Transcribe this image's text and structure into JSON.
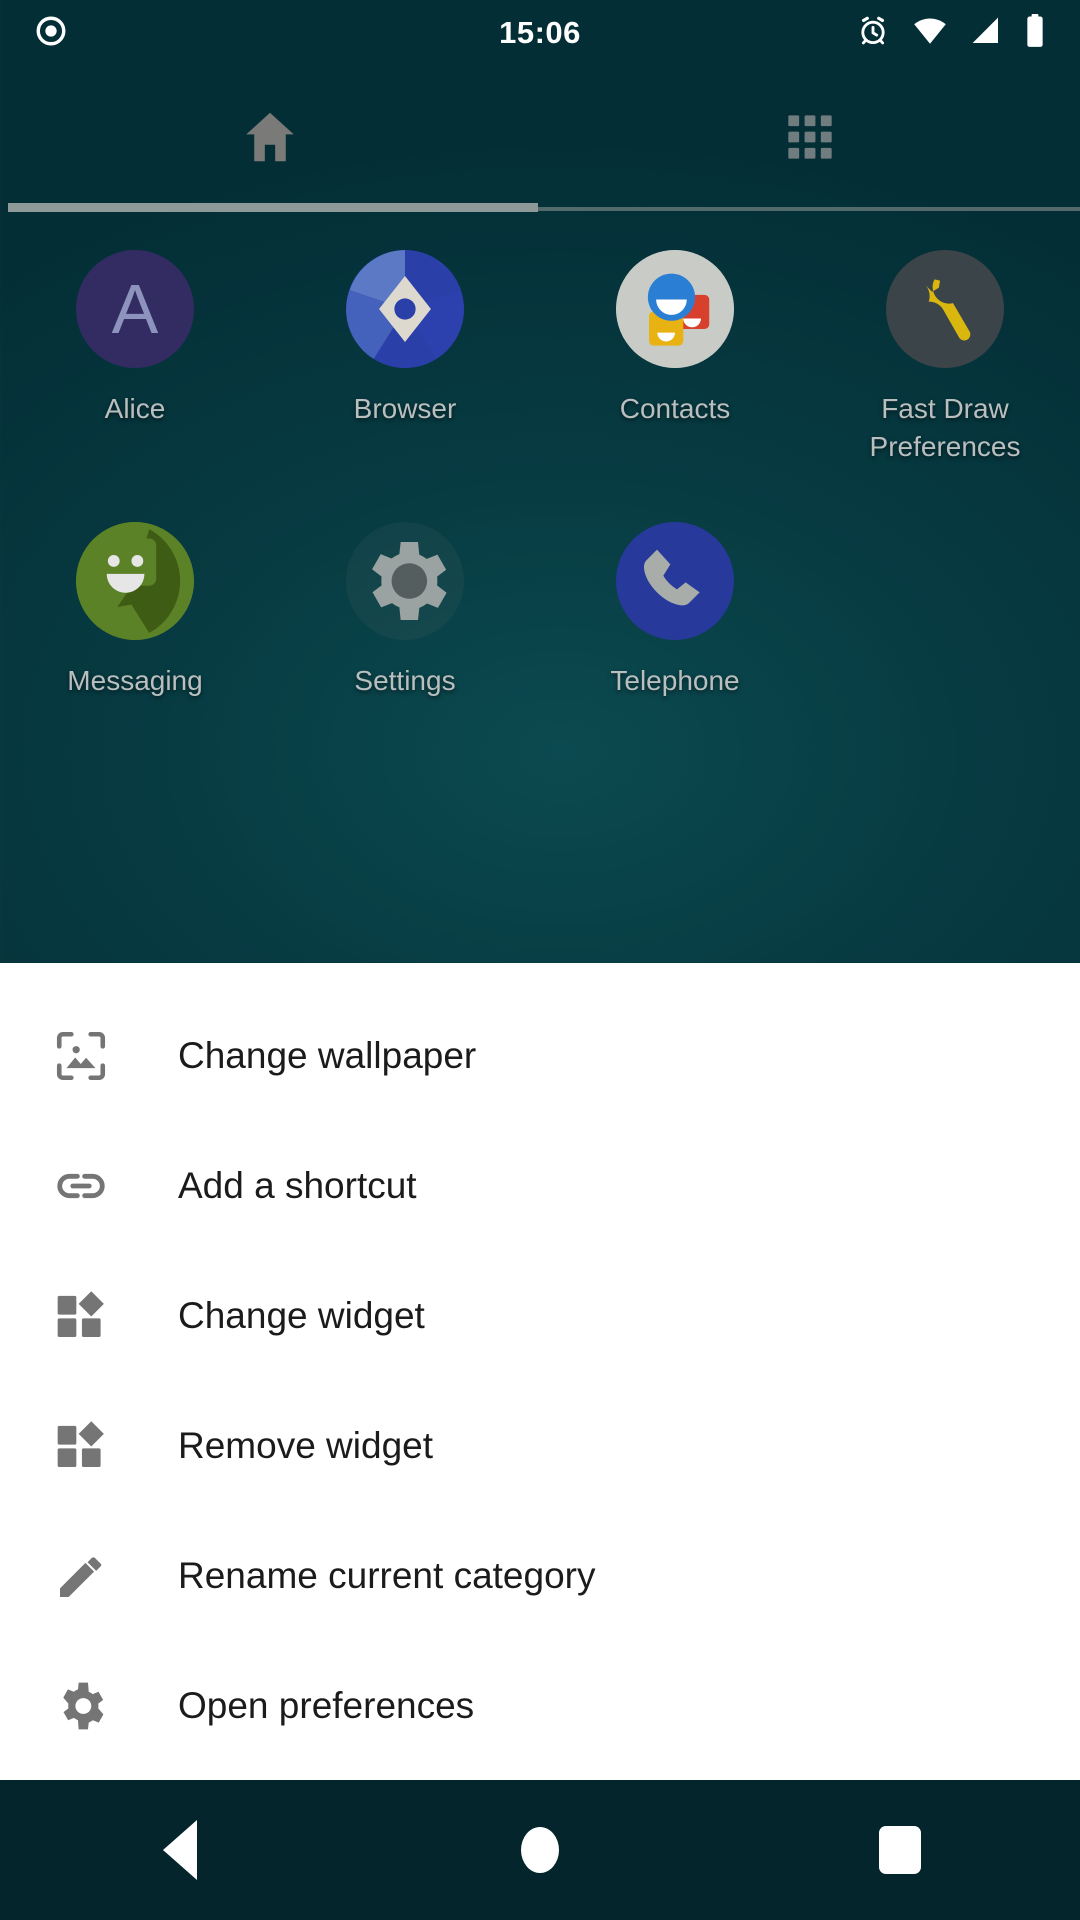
{
  "status_bar": {
    "time": "15:06",
    "left_icons": [
      {
        "name": "screen-record-icon",
        "glyph": "record"
      }
    ],
    "right_icons": [
      {
        "name": "alarm-icon",
        "glyph": "alarm"
      },
      {
        "name": "wifi-icon",
        "glyph": "wifi"
      },
      {
        "name": "cellular-signal-icon",
        "glyph": "signal"
      },
      {
        "name": "battery-icon",
        "glyph": "battery"
      }
    ]
  },
  "tabs": [
    {
      "id": "home",
      "icon": "home-icon",
      "active": true
    },
    {
      "id": "app-drawer",
      "icon": "grid-icon",
      "active": false
    }
  ],
  "home_screen": {
    "rows": [
      [
        {
          "label": "Alice",
          "icon": "alice-avatar-icon"
        },
        {
          "label": "Browser",
          "icon": "browser-icon"
        },
        {
          "label": "Contacts",
          "icon": "contacts-icon"
        },
        {
          "label": "Fast Draw Preferences",
          "icon": "wrench-icon"
        }
      ],
      [
        {
          "label": "Messaging",
          "icon": "messaging-icon"
        },
        {
          "label": "Settings",
          "icon": "settings-gear-icon"
        },
        {
          "label": "Telephone",
          "icon": "phone-icon"
        }
      ]
    ]
  },
  "context_menu": {
    "items": [
      {
        "label": "Change wallpaper",
        "icon": "image-icon"
      },
      {
        "label": "Add a shortcut",
        "icon": "link-icon"
      },
      {
        "label": "Change widget",
        "icon": "widget-icon"
      },
      {
        "label": "Remove widget",
        "icon": "widget-icon"
      },
      {
        "label": "Rename current category",
        "icon": "pencil-icon"
      },
      {
        "label": "Open preferences",
        "icon": "gear-icon"
      }
    ]
  },
  "nav_bar": {
    "buttons": [
      {
        "id": "back",
        "icon": "back-triangle-icon"
      },
      {
        "id": "home",
        "icon": "home-circle-icon"
      },
      {
        "id": "recents",
        "icon": "recents-square-icon"
      }
    ]
  },
  "colors": {
    "wallpaper": "#073b42",
    "menu_background": "#ffffff",
    "menu_text": "#1b1b1b",
    "menu_icon": "#757575",
    "app_label": "#b9bebe",
    "nav_bar": "#04252c",
    "status_text": "#ffffff"
  }
}
